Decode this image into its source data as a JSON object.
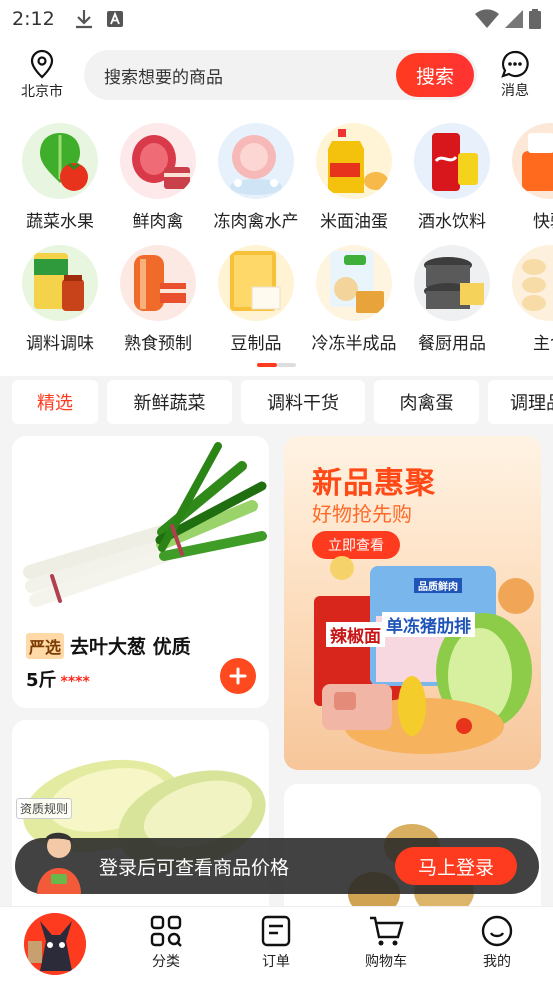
{
  "status_bar": {
    "time": "2:12"
  },
  "header": {
    "location": "北京市",
    "search_placeholder": "搜索想要的商品",
    "search_button": "搜索",
    "message_label": "消息"
  },
  "categories": {
    "row1": [
      {
        "label": "蔬菜水果",
        "icon": "vegetables-icon"
      },
      {
        "label": "鲜肉禽",
        "icon": "fresh-meat-icon"
      },
      {
        "label": "冻肉禽水产",
        "icon": "frozen-meat-icon"
      },
      {
        "label": "米面油蛋",
        "icon": "rice-oil-icon"
      },
      {
        "label": "酒水饮料",
        "icon": "drinks-icon"
      },
      {
        "label": "快驴",
        "icon": "kuailv-icon"
      }
    ],
    "row2": [
      {
        "label": "调料调味",
        "icon": "seasoning-icon"
      },
      {
        "label": "熟食预制",
        "icon": "cooked-food-icon"
      },
      {
        "label": "豆制品",
        "icon": "tofu-icon"
      },
      {
        "label": "冷冻半成品",
        "icon": "frozen-semi-icon"
      },
      {
        "label": "餐厨用品",
        "icon": "kitchenware-icon"
      },
      {
        "label": "主食",
        "icon": "staple-food-icon"
      }
    ],
    "pager": {
      "current_page": 1,
      "total_pages": 2
    }
  },
  "tabs": [
    {
      "label": "精选",
      "active": true
    },
    {
      "label": "新鲜蔬菜",
      "active": false
    },
    {
      "label": "调料干货",
      "active": false
    },
    {
      "label": "肉禽蛋",
      "active": false
    },
    {
      "label": "调理品",
      "active": false
    }
  ],
  "product1": {
    "badge": "严选",
    "name": "去叶大葱 优质",
    "unit": "5斤",
    "price_masked": "****"
  },
  "banner": {
    "title": "新品惠聚",
    "subtitle": "好物抢先购",
    "cta": "立即查看",
    "pack_left": "辣椒面",
    "pack_right": "单冻猪肋排",
    "pack_right_brand": "品质鲜肉"
  },
  "product2": {
    "rule_tag": "资质规则"
  },
  "login_bar": {
    "text": "登录后可查看商品价格",
    "button": "马上登录"
  },
  "tabbar": [
    {
      "label": "分类",
      "icon": "category-icon"
    },
    {
      "label": "订单",
      "icon": "order-icon"
    },
    {
      "label": "购物车",
      "icon": "cart-icon"
    },
    {
      "label": "我的",
      "icon": "profile-icon"
    }
  ],
  "colors": {
    "accent": "#ff3b1f",
    "price": "#ff2a1f"
  }
}
